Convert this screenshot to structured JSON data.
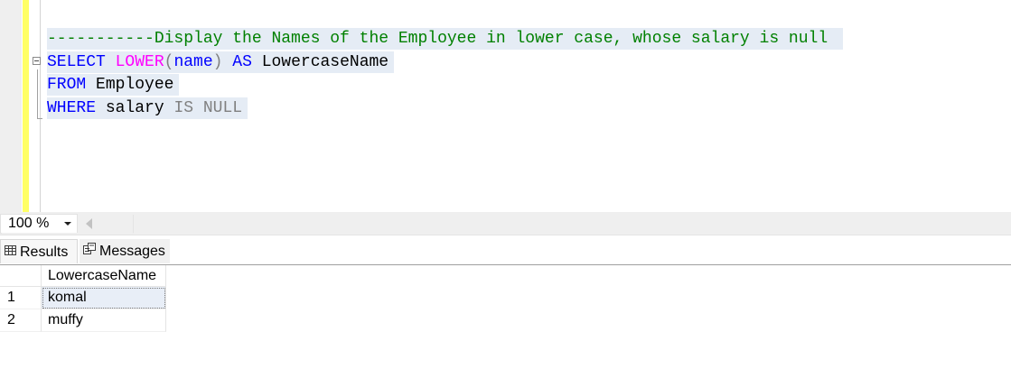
{
  "editor": {
    "lines": [
      {
        "tokens": [
          {
            "text": "-----------Display the Names of the Employee in lower case, whose salary is null ",
            "cls": "c-comment"
          }
        ]
      },
      {
        "tokens": [
          {
            "text": "SELECT ",
            "cls": "c-kw"
          },
          {
            "text": "LOWER",
            "cls": "c-fn"
          },
          {
            "text": "(",
            "cls": "c-gray"
          },
          {
            "text": "name",
            "cls": "c-kw"
          },
          {
            "text": ") ",
            "cls": "c-gray"
          },
          {
            "text": "AS ",
            "cls": "c-kw"
          },
          {
            "text": "LowercaseName",
            "cls": "c-ident"
          }
        ]
      },
      {
        "tokens": [
          {
            "text": "FROM ",
            "cls": "c-kw"
          },
          {
            "text": "Employee",
            "cls": "c-ident"
          }
        ]
      },
      {
        "tokens": [
          {
            "text": "WHERE ",
            "cls": "c-kw"
          },
          {
            "text": "salary ",
            "cls": "c-ident"
          },
          {
            "text": "IS NULL",
            "cls": "c-gray"
          }
        ]
      }
    ]
  },
  "zoom": {
    "value": "100 %"
  },
  "tabs": {
    "results": "Results",
    "messages": "Messages"
  },
  "results": {
    "columns": [
      "LowercaseName"
    ],
    "rows": [
      {
        "num": "1",
        "value": "komal"
      },
      {
        "num": "2",
        "value": "muffy"
      }
    ]
  },
  "colors": {
    "comment": "#008000",
    "keyword": "#0000ff",
    "function": "#ff00ff",
    "operator": "#808080",
    "margin_marker": "#ffff66",
    "selection": "#e5ecf5"
  },
  "icons": {
    "results_tab": "grid-icon",
    "messages_tab": "messages-icon",
    "collapse": "collapse-minus-icon",
    "scroll": "scroll-left-arrow-icon"
  }
}
